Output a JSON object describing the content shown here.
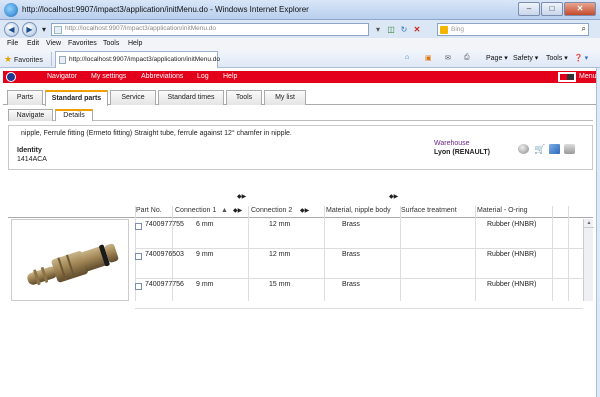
{
  "window": {
    "title": "http://localhost:9907/impact3/application/initMenu.do - Windows Internet Explorer",
    "minimize": "–",
    "maximize": "□",
    "close": "✕"
  },
  "addressbar": {
    "url": "http://localhost:9907/impact3/application/initMenu.do",
    "search_placeholder": "Bing",
    "back": "◀",
    "forward": "▶"
  },
  "menubar": {
    "items": [
      "File",
      "Edit",
      "View",
      "Favorites",
      "Tools",
      "Help"
    ]
  },
  "favoritesbar": {
    "favorites_label": "Favorites",
    "tab_title": "http://localhost:9907/impact3/application/initMenu.do",
    "tools": [
      "Page ▾",
      "Safety ▾",
      "Tools ▾",
      "❓ ▾"
    ]
  },
  "appnav": {
    "items": [
      "Navigator",
      "My settings",
      "Abbreviations",
      "Log",
      "Help"
    ],
    "menu_label": "Menu"
  },
  "tabs": {
    "items": [
      "Parts",
      "Standard parts",
      "Service",
      "Standard times",
      "Tools",
      "My list"
    ],
    "active": "Standard parts"
  },
  "subtabs": {
    "items": [
      "Navigate",
      "Details"
    ],
    "active": "Details"
  },
  "part_header": {
    "description": "nipple, Ferrule fitting (Ermeto fitting) Straight tube, ferrule against 12° chamfer in nipple.",
    "identity_label": "Identity",
    "identity_value": "1414ACA",
    "warehouse_label": "Warehouse",
    "warehouse_value": "Lyon (RENAULT)"
  },
  "table": {
    "columns": [
      "Part No.",
      "Connection 1",
      "Connection 2",
      "Material, nipple body",
      "Surface treatment",
      "Material - O-ring"
    ],
    "sort_indicator": "▲",
    "rows": [
      {
        "part_no": "7400977755",
        "connection_1": "6 mm",
        "connection_2": "12 mm",
        "material_body": "Brass",
        "surface": "",
        "material_oring": "Rubber (HNBR)"
      },
      {
        "part_no": "7400976503",
        "connection_1": "9 mm",
        "connection_2": "12 mm",
        "material_body": "Brass",
        "surface": "",
        "material_oring": "Rubber (HNBR)"
      },
      {
        "part_no": "7400977756",
        "connection_1": "9 mm",
        "connection_2": "15 mm",
        "material_body": "Brass",
        "surface": "",
        "material_oring": "Rubber (HNBR)"
      }
    ]
  },
  "colors": {
    "accent_red": "#e2001a",
    "tab_highlight": "#f0a000",
    "link_purple": "#6a2a87"
  }
}
